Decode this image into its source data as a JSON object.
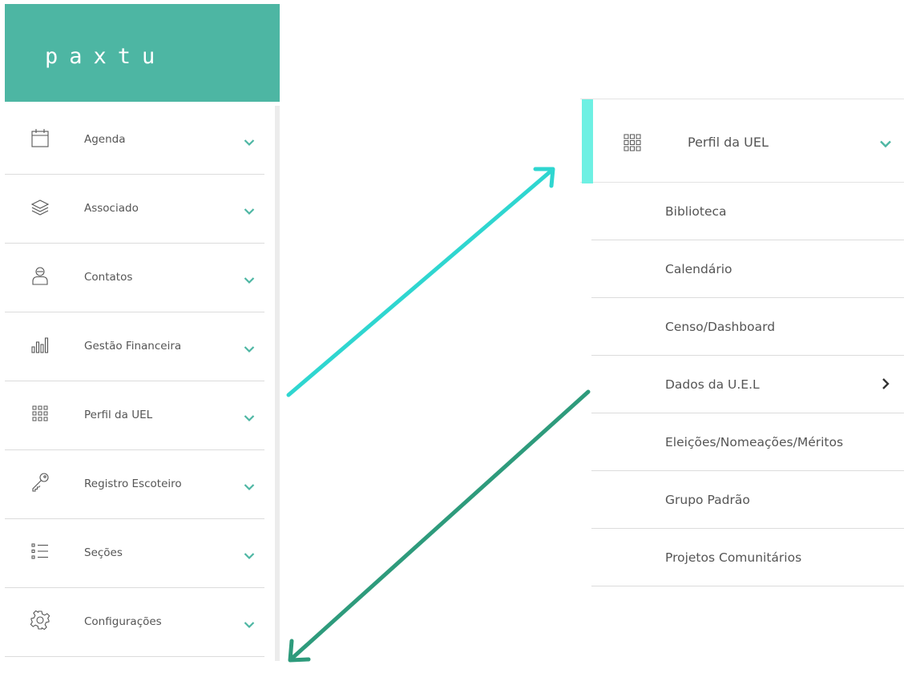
{
  "logo": {
    "text": "paxtu"
  },
  "colors": {
    "brand": "#4db6a3",
    "accent": "#6ef0e3",
    "arrow_up": "#2fd6d0",
    "arrow_down": "#2e9b7c",
    "chevron": "#4db6a3"
  },
  "sidebar": {
    "items": [
      {
        "label": "Agenda",
        "icon": "calendar-icon"
      },
      {
        "label": "Associado",
        "icon": "layers-icon"
      },
      {
        "label": "Contatos",
        "icon": "contact-person-icon"
      },
      {
        "label": "Gestão Financeira",
        "icon": "bar-chart-icon"
      },
      {
        "label": "Perfil da UEL",
        "icon": "grid-icon"
      },
      {
        "label": "Registro Escoteiro",
        "icon": "key-icon"
      },
      {
        "label": "Seções",
        "icon": "list-icon"
      },
      {
        "label": "Configurações",
        "icon": "gear-icon"
      }
    ]
  },
  "panel": {
    "header": {
      "label": "Perfil da UEL",
      "icon": "grid-icon"
    },
    "items": [
      {
        "label": "Biblioteca"
      },
      {
        "label": "Calendário"
      },
      {
        "label": "Censo/Dashboard"
      },
      {
        "label": "Dados da U.E.L",
        "has_submenu": true
      },
      {
        "label": "Eleições/Nomeações/Méritos"
      },
      {
        "label": "Grupo Padrão"
      },
      {
        "label": "Projetos Comunitários"
      }
    ]
  }
}
